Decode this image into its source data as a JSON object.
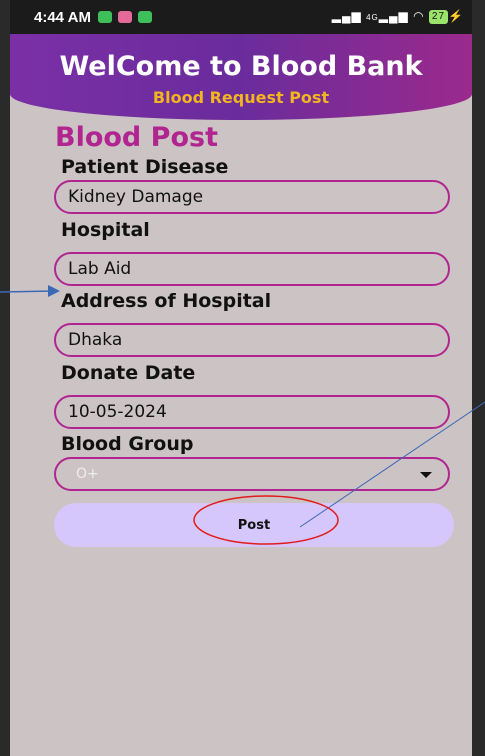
{
  "status_bar": {
    "time": "4:44 AM",
    "network": "4G",
    "battery": "27"
  },
  "header": {
    "title": "WelCome to Blood Bank",
    "subtitle": "Blood Request Post"
  },
  "form": {
    "title": "Blood Post",
    "patient_disease": {
      "label": "Patient Disease",
      "value": "Kidney Damage"
    },
    "hospital": {
      "label": "Hospital",
      "value": "Lab Aid"
    },
    "address": {
      "label": "Address of Hospital",
      "value": "Dhaka"
    },
    "donate_date": {
      "label": "Donate Date",
      "value": "10-05-2024"
    },
    "blood_group": {
      "label": "Blood Group",
      "selected": "O+"
    },
    "post_label": "Post"
  },
  "colors": {
    "accent": "#b0258f",
    "header_purple": "#7b2fa6",
    "subtitle_gold": "#f2b51f",
    "button_bg": "#d5c6fb",
    "screen_bg": "#ccc4c4"
  }
}
